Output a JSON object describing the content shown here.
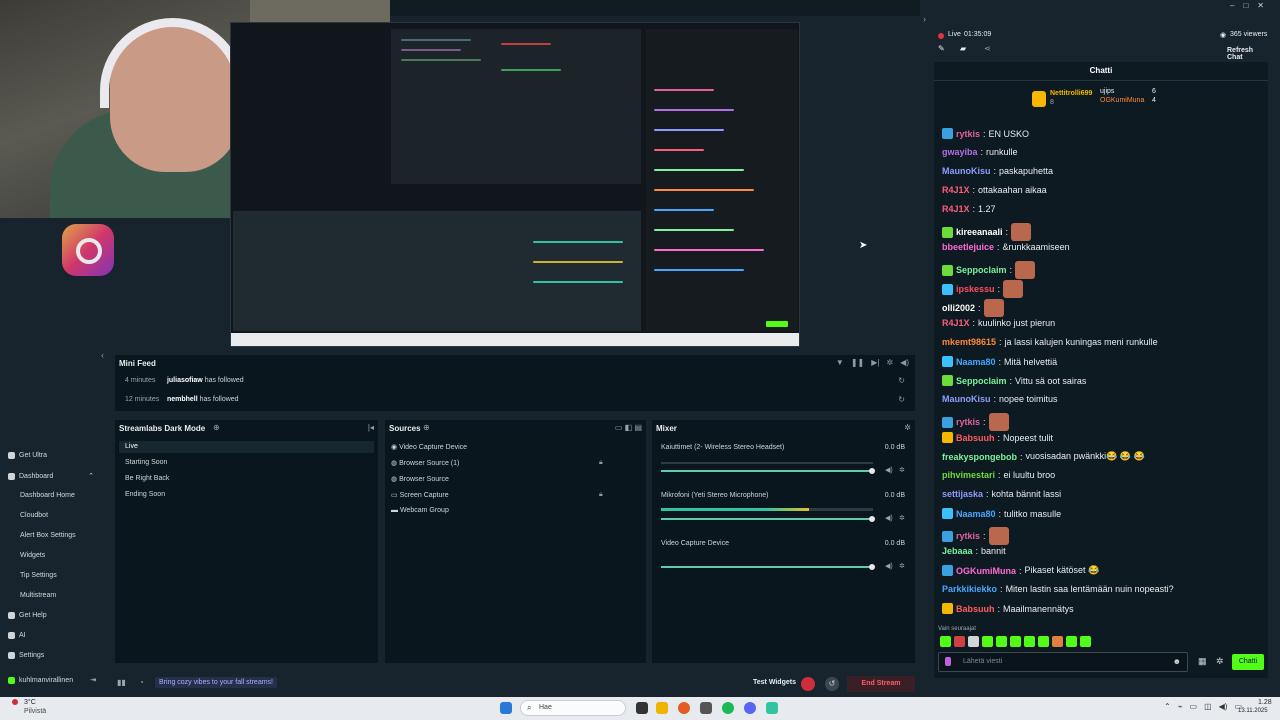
{
  "stream": {
    "live_label": "Live",
    "live_time": "01:35:09",
    "viewers": "365 viewers",
    "refresh_chat": "Refresh Chat"
  },
  "chat": {
    "title": "Chatti",
    "leaderboard": [
      {
        "name": "Nettitrolli699",
        "count": "8"
      },
      {
        "name": "ujips",
        "count": "6"
      },
      {
        "name": "OGKumiMuna",
        "count": "4"
      }
    ],
    "messages": [
      {
        "user": "rytkis",
        "text": "EN USKO",
        "color": "#e060a0",
        "badge": "#3aa0e0"
      },
      {
        "user": "gwayiba",
        "text": "runkulle",
        "color": "#b46ee6",
        "badge": ""
      },
      {
        "user": "MaunoKisu",
        "text": "paskapuhetta",
        "color": "#8c9dfc",
        "badge": ""
      },
      {
        "user": "R4J1X",
        "text": "ottakaahan aikaa",
        "color": "#ff5c7a",
        "badge": ""
      },
      {
        "user": "R4J1X",
        "text": "1.27",
        "color": "#ff5c7a",
        "badge": ""
      },
      {
        "user": "kireeanaali",
        "text": "",
        "color": "#ffffff",
        "badge": "#6ddb3a",
        "emote": true
      },
      {
        "user": "bbeetlejuice",
        "text": "&runkkaamiseen",
        "color": "#ff6ad5",
        "badge": ""
      },
      {
        "user": "Seppoclaim",
        "text": "",
        "color": "#7cf29a",
        "badge": "#6ddb3a",
        "emote": true
      },
      {
        "user": "ipskessu",
        "text": "",
        "color": "#ff4d5a",
        "badge": "#3ac0ff",
        "emote": true
      },
      {
        "user": "olli2002",
        "text": "",
        "color": "#ffffff",
        "badge": "",
        "emote": true
      },
      {
        "user": "R4J1X",
        "text": "kuulinko just pierun",
        "color": "#ff5c7a",
        "badge": ""
      },
      {
        "user": "mkemt98615",
        "text": "ja lassi kalujen kuningas meni runkulle",
        "color": "#ff8a3a",
        "badge": ""
      },
      {
        "user": "Naama80",
        "text": "Mitä helvettiä",
        "color": "#48a8ff",
        "badge": "#3ac0ff"
      },
      {
        "user": "Seppoclaim",
        "text": "Vittu sä oot sairas",
        "color": "#7cf29a",
        "badge": "#6ddb3a"
      },
      {
        "user": "MaunoKisu",
        "text": "nopee toimitus",
        "color": "#8c9dfc",
        "badge": ""
      },
      {
        "user": "rytkis",
        "text": "",
        "color": "#e060a0",
        "badge": "#3aa0e0",
        "emote": true
      },
      {
        "user": "Babsuuh",
        "text": "Nopeest tulit",
        "color": "#ff5c5c",
        "badge": "#f5b700"
      },
      {
        "user": "freakyspongebob",
        "text": "vuosisadan pwänkki😂 😂 😂",
        "color": "#7cf29a",
        "badge": ""
      },
      {
        "user": "pihvimestari",
        "text": "ei luultu broo",
        "color": "#6ddb3a",
        "badge": ""
      },
      {
        "user": "settijaska",
        "text": "kohta bännit lassi",
        "color": "#8c9dfc",
        "badge": ""
      },
      {
        "user": "Naama80",
        "text": "tulitko masulle",
        "color": "#48a8ff",
        "badge": "#3ac0ff"
      },
      {
        "user": "rytkis",
        "text": "",
        "color": "#e060a0",
        "badge": "#3aa0e0",
        "emote": true
      },
      {
        "user": "Jebaaa",
        "text": "bannit",
        "color": "#7cf29a",
        "badge": ""
      },
      {
        "user": "OGKumiMuna",
        "text": "Pikaset kätöset 😂",
        "color": "#ff6ad5",
        "badge": "#3aa0e0"
      },
      {
        "user": "Parkkikiekko",
        "text": "Miten lastin saa lentämään nuin nopeasti?",
        "color": "#48a8ff",
        "badge": ""
      },
      {
        "user": "Babsuuh",
        "text": "Maailmanennätys",
        "color": "#ff5c5c",
        "badge": "#f5b700"
      }
    ],
    "followers_only": "Vain seuraajat",
    "input_placeholder": "Lähetä viesti",
    "send_label": "Chatti"
  },
  "mini_feed": {
    "title": "Mini Feed",
    "items": [
      {
        "time": "4 minutes",
        "user": "juliasofiaw",
        "action": "has followed"
      },
      {
        "time": "12 minutes",
        "user": "nembhell",
        "action": "has followed"
      }
    ]
  },
  "scenes": {
    "title": "Streamlabs Dark Mode",
    "items": [
      "Live",
      "Starting Soon",
      "Be Right Back",
      "Ending Soon"
    ],
    "selected": 0
  },
  "sources": {
    "title": "Sources",
    "items": [
      "Video Capture Device",
      "Browser Source (1)",
      "Browser Source",
      "Screen Capture",
      "Webcam Group"
    ]
  },
  "mixer": {
    "title": "Mixer",
    "channels": [
      {
        "name": "Kaiuttimet (2- Wireless Stereo Headset)",
        "level": "0.0 dB",
        "fill": 0.0
      },
      {
        "name": "Mikrofoni (Yeti Stereo Microphone)",
        "level": "0.0 dB",
        "fill": 0.7
      },
      {
        "name": "Video Capture Device",
        "level": "0.0 dB",
        "fill": 0.0
      }
    ]
  },
  "sidebar": {
    "items": [
      {
        "label": "Get Ultra",
        "icon": "ultra-icon"
      },
      {
        "label": "Dashboard",
        "icon": "dashboard-icon"
      },
      {
        "label": "Dashboard Home",
        "icon": ""
      },
      {
        "label": "Cloudbot",
        "icon": ""
      },
      {
        "label": "Alert Box Settings",
        "icon": ""
      },
      {
        "label": "Widgets",
        "icon": ""
      },
      {
        "label": "Tip Settings",
        "icon": ""
      },
      {
        "label": "Multistream",
        "icon": ""
      },
      {
        "label": "Get Help",
        "icon": "help-icon"
      },
      {
        "label": "AI",
        "icon": "ai-icon"
      },
      {
        "label": "Settings",
        "icon": "gear-icon"
      }
    ],
    "user": "kuhlmanvirallinen"
  },
  "footer": {
    "promo": "Bring cozy vibes to your fall streams!",
    "test_widgets": "Test Widgets",
    "end_stream": "End Stream"
  },
  "taskbar": {
    "weather_temp": "3°C",
    "weather_desc": "Pilvistä",
    "search_placeholder": "Hae",
    "time": "1.28",
    "date": "13.11.2025"
  },
  "colors": {
    "accent": "#31c3a2",
    "danger": "#e0343f",
    "chat_green": "#53fc18",
    "panel_bg": "#09161d"
  }
}
